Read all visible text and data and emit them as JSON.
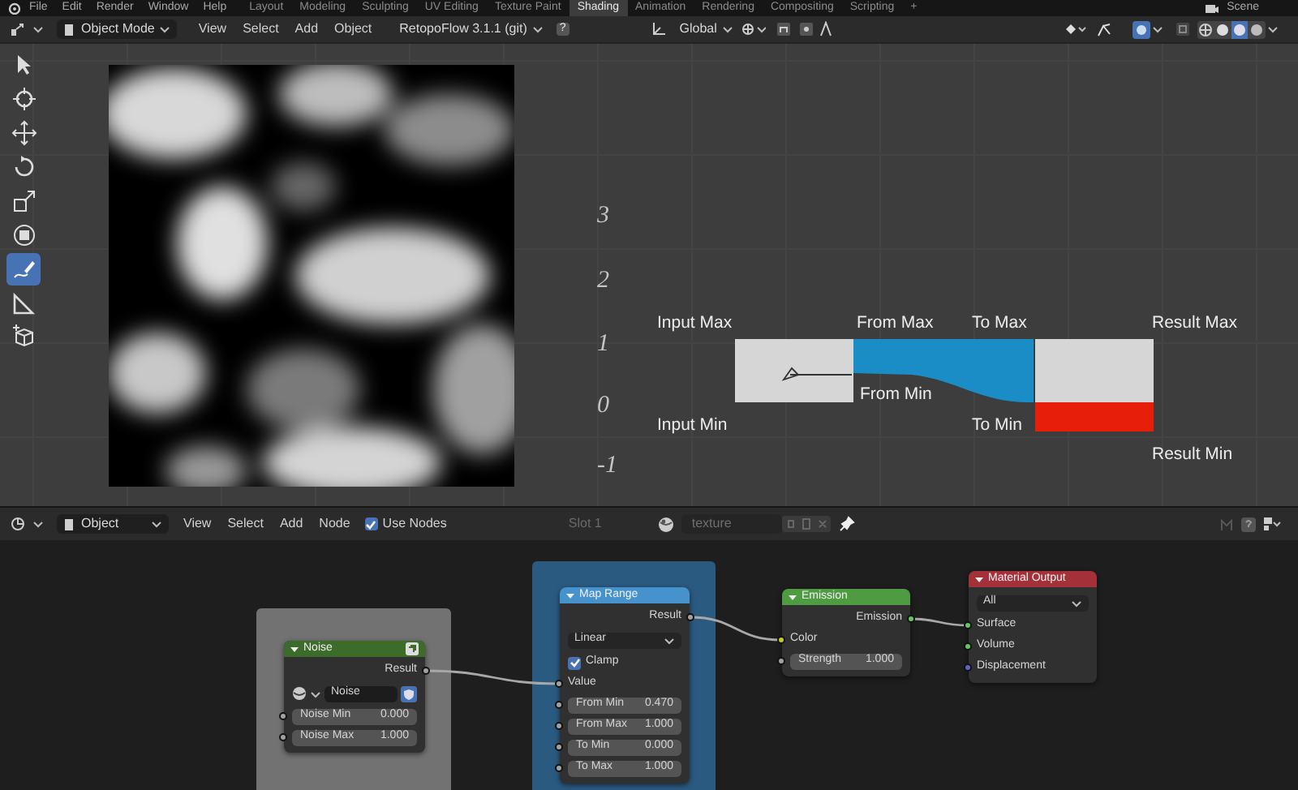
{
  "top_bar": {
    "menus": [
      "File",
      "Edit",
      "Render",
      "Window",
      "Help"
    ],
    "workspaces": [
      {
        "label": "Layout",
        "selected": false
      },
      {
        "label": "Modeling",
        "selected": false
      },
      {
        "label": "Sculpting",
        "selected": false
      },
      {
        "label": "UV Editing",
        "selected": false
      },
      {
        "label": "Texture Paint",
        "selected": false
      },
      {
        "label": "Shading",
        "selected": true
      },
      {
        "label": "Animation",
        "selected": false
      },
      {
        "label": "Rendering",
        "selected": false
      },
      {
        "label": "Compositing",
        "selected": false
      },
      {
        "label": "Scripting",
        "selected": false
      }
    ],
    "add_workspace": "+",
    "scene": "Scene"
  },
  "viewport_header": {
    "mode": "Object Mode",
    "menus": [
      "View",
      "Select",
      "Add",
      "Object"
    ],
    "addon": "RetopoFlow 3.1.1 (git)",
    "addon_help": "?",
    "orientation": "Global"
  },
  "tools": [
    {
      "kind": "select",
      "selected": false
    },
    {
      "kind": "cursor",
      "selected": false
    },
    {
      "kind": "move",
      "selected": false
    },
    {
      "kind": "rotate",
      "selected": false
    },
    {
      "kind": "scale",
      "selected": false
    },
    {
      "kind": "transform",
      "selected": false
    },
    {
      "kind": "annotate",
      "selected": true
    },
    {
      "kind": "measure",
      "selected": false
    },
    {
      "kind": "add_cube",
      "selected": false
    }
  ],
  "viewport": {
    "picture": {
      "kind": "picture"
    },
    "axis_marks": [
      "3",
      "2",
      "1",
      "0",
      "-1"
    ],
    "diagram_labels": [
      "Input Max",
      "From Max",
      "To Max",
      "Result Max",
      "From Min",
      "Input Min",
      "To Min",
      "Result Min"
    ]
  },
  "node_header": {
    "object_type": "Object",
    "menus": [
      "View",
      "Select",
      "Add",
      "Node"
    ],
    "use_nodes": {
      "label": "Use Nodes",
      "checked": true
    },
    "slot": "Slot 1",
    "material": "texture"
  },
  "nodes": [
    {
      "kind": "group",
      "title": "Noise",
      "rows": [
        {
          "kind": "output",
          "label": "Result",
          "color": "#a1a1a1"
        },
        {
          "kind": "datablock",
          "value": "Noise"
        },
        {
          "kind": "value",
          "label": "Noise Min",
          "value": "0.000",
          "color": "#a1a1a1"
        },
        {
          "kind": "value",
          "label": "Noise Max",
          "value": "1.000",
          "color": "#a1a1a1"
        }
      ]
    },
    {
      "kind": "converter",
      "title": "Map Range",
      "rows": [
        {
          "kind": "output",
          "label": "Result",
          "color": "#a1a1a1"
        },
        {
          "kind": "dropdown",
          "value": "Linear"
        },
        {
          "kind": "checkbox",
          "label": "Clamp",
          "checked": true
        },
        {
          "kind": "input",
          "label": "Value",
          "color": "#a1a1a1"
        },
        {
          "kind": "value",
          "label": "From Min",
          "value": "0.470",
          "color": "#a1a1a1"
        },
        {
          "kind": "value",
          "label": "From Max",
          "value": "1.000",
          "color": "#a1a1a1"
        },
        {
          "kind": "value",
          "label": "To Min",
          "value": "0.000",
          "color": "#a1a1a1"
        },
        {
          "kind": "value",
          "label": "To Max",
          "value": "1.000",
          "color": "#a1a1a1"
        }
      ]
    },
    {
      "kind": "shader",
      "title": "Emission",
      "rows": [
        {
          "kind": "output",
          "label": "Emission",
          "color": "#63c763"
        },
        {
          "kind": "input",
          "label": "Color",
          "color": "#c7c729"
        },
        {
          "kind": "value",
          "label": "Strength",
          "value": "1.000",
          "color": "#a1a1a1"
        }
      ]
    },
    {
      "kind": "output",
      "title": "Material Output",
      "rows": [
        {
          "kind": "dropdown",
          "value": "All"
        },
        {
          "kind": "input",
          "label": "Surface",
          "color": "#63c763"
        },
        {
          "kind": "input",
          "label": "Volume",
          "color": "#63c763"
        },
        {
          "kind": "input",
          "label": "Displacement",
          "color": "#6363c7"
        }
      ]
    }
  ]
}
